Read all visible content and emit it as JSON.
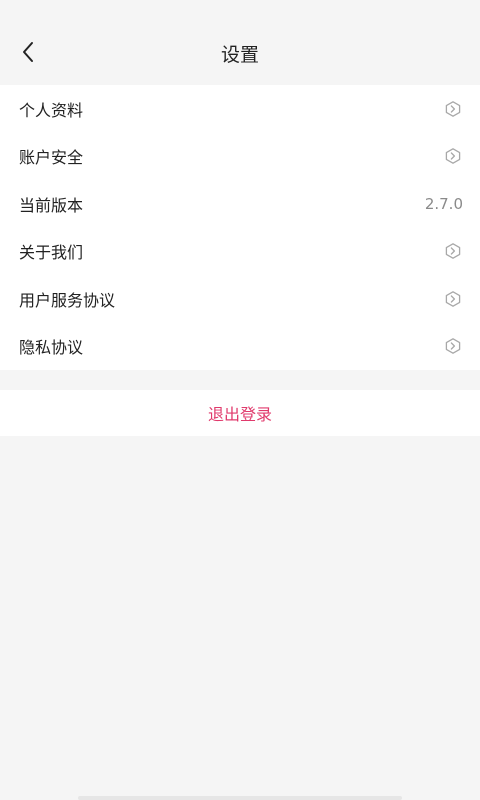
{
  "header": {
    "title": "设置",
    "back_icon": "chevron-left-icon"
  },
  "menu": {
    "items": [
      {
        "label": "个人资料",
        "trailing_icon": "chevron-right-icon"
      },
      {
        "label": "账户安全",
        "trailing_icon": "chevron-right-icon"
      },
      {
        "label": "当前版本",
        "value": "2.7.0"
      },
      {
        "label": "关于我们",
        "trailing_icon": "chevron-right-icon"
      },
      {
        "label": "用户服务协议",
        "trailing_icon": "chevron-right-icon"
      },
      {
        "label": "隐私协议",
        "trailing_icon": "chevron-right-icon"
      }
    ]
  },
  "logout": {
    "label": "退出登录",
    "color": "#e03a6c"
  },
  "colors": {
    "background": "#f5f5f5",
    "card": "#ffffff",
    "accent": "#e03a6c"
  }
}
